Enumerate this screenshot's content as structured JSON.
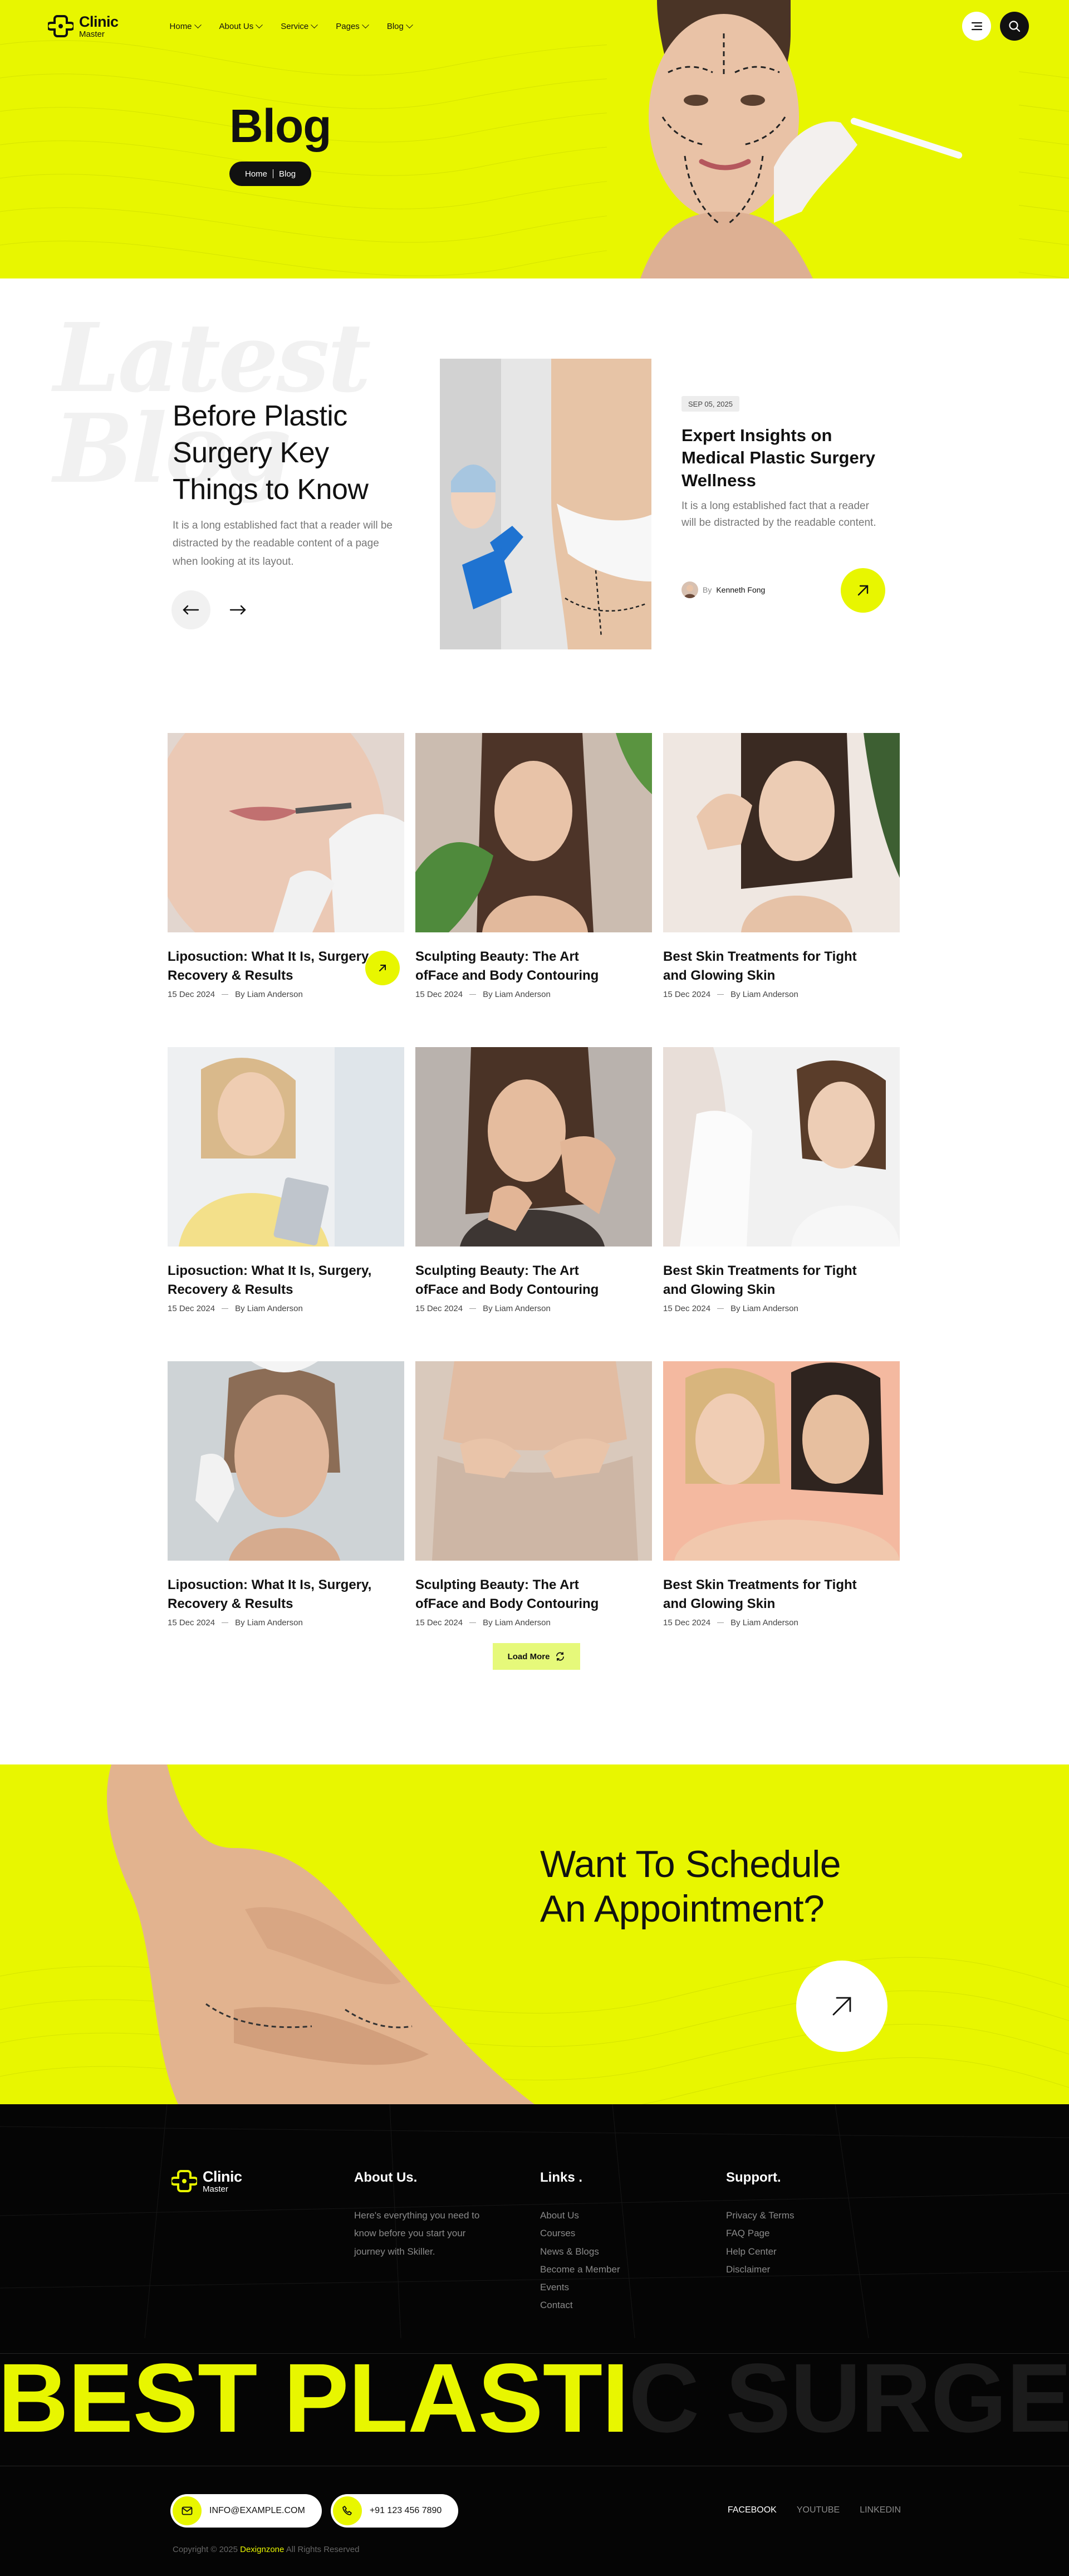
{
  "brand": {
    "name": "Clinic",
    "tagline": "Master"
  },
  "nav": {
    "items": [
      {
        "label": "Home"
      },
      {
        "label": "About Us"
      },
      {
        "label": "Service"
      },
      {
        "label": "Pages"
      },
      {
        "label": "Blog"
      }
    ]
  },
  "hero": {
    "title": "Blog",
    "breadcrumb": [
      "Home",
      "Blog"
    ]
  },
  "featured": {
    "ghost_text": [
      "Latest",
      "Blog"
    ],
    "title": "Before Plastic Surgery Key Things to Know",
    "text": "It is a long established fact that a reader will be distracted by the readable content of a page when looking at its layout.",
    "card": {
      "date": "SEP 05, 2025",
      "title": "Expert Insights on Medical Plastic Surgery Wellness",
      "text": "It is a long established fact that a reader will be distracted by the readable content.",
      "author_prefix": "By",
      "author": "Kenneth Fong"
    }
  },
  "posts": [
    {
      "title": "Liposuction: What It Is, Surgery, Recovery & Results",
      "date": "15 Dec 2024",
      "author": "By Liam Anderson"
    },
    {
      "title": "Sculpting Beauty: The Art ofFace and Body Contouring",
      "date": "15 Dec 2024",
      "author": "By Liam Anderson"
    },
    {
      "title": "Best Skin Treatments for Tight and Glowing Skin",
      "date": "15 Dec 2024",
      "author": "By Liam Anderson"
    },
    {
      "title": "Liposuction: What It Is, Surgery, Recovery & Results",
      "date": "15 Dec 2024",
      "author": "By Liam Anderson"
    },
    {
      "title": "Sculpting Beauty: The Art ofFace and Body Contouring",
      "date": "15 Dec 2024",
      "author": "By Liam Anderson"
    },
    {
      "title": "Best Skin Treatments for Tight and Glowing Skin",
      "date": "15 Dec 2024",
      "author": "By Liam Anderson"
    },
    {
      "title": "Liposuction: What It Is, Surgery, Recovery & Results",
      "date": "15 Dec 2024",
      "author": "By Liam Anderson"
    },
    {
      "title": "Sculpting Beauty: The Art ofFace and Body Contouring",
      "date": "15 Dec 2024",
      "author": "By Liam Anderson"
    },
    {
      "title": "Best Skin Treatments for Tight and Glowing Skin",
      "date": "15 Dec 2024",
      "author": "By Liam Anderson"
    }
  ],
  "load_more": "Load More",
  "appointment": {
    "line1": "Want To Schedule",
    "line2": "An Appointment?"
  },
  "footer": {
    "about": {
      "heading": "About Us.",
      "text": "Here's everything you need to know before you start your journey with Skiller."
    },
    "links": {
      "heading": "Links .",
      "items": [
        "About Us",
        "Courses",
        "News & Blogs",
        "Become a Member",
        "Events",
        "Contact"
      ]
    },
    "support": {
      "heading": "Support.",
      "items": [
        "Privacy & Terms",
        "FAQ Page",
        "Help Center",
        "Disclaimer"
      ]
    },
    "marquee_hi": "BEST PLASTI",
    "marquee_lo": "C SURGERY",
    "email": "INFO@EXAMPLE.COM",
    "phone": "+91 123 456 7890",
    "socials": [
      "FACEBOOK",
      "YOUTUBE",
      "LINKEDIN"
    ],
    "copyright_prefix": "Copyright © 2025",
    "copyright_brand": "Dexignzone",
    "copyright_suffix": "All Rights Reserved"
  },
  "colors": {
    "accent": "#e8f600",
    "dark": "#050505"
  },
  "icons": [
    "menu-icon",
    "search-icon",
    "arrow-left-icon",
    "arrow-right-icon",
    "arrow-up-right-icon",
    "refresh-icon",
    "mail-icon",
    "phone-icon"
  ]
}
